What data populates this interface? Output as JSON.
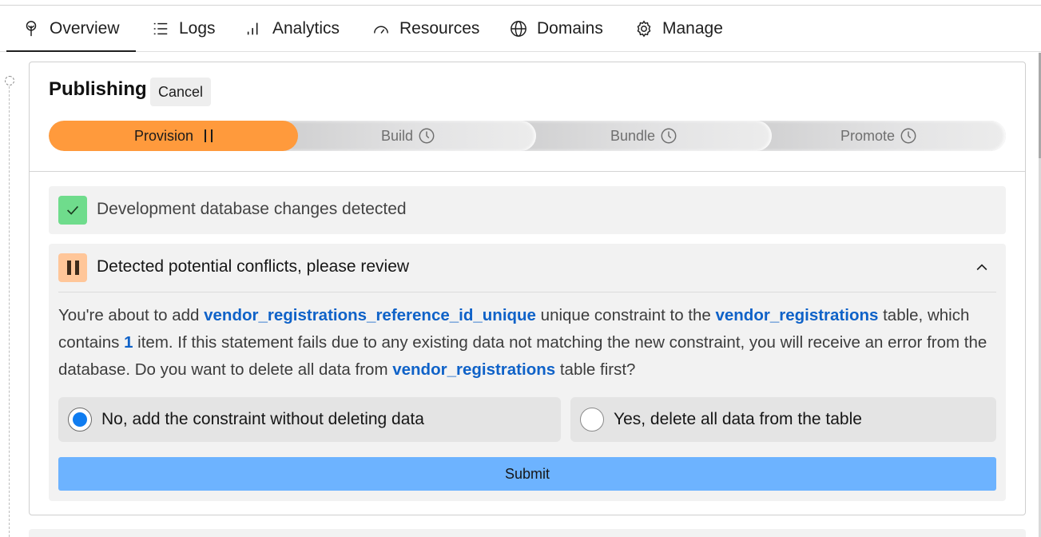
{
  "tabs": [
    {
      "label": "Overview",
      "icon": "tree-icon",
      "active": true
    },
    {
      "label": "Logs",
      "icon": "list-icon",
      "active": false
    },
    {
      "label": "Analytics",
      "icon": "bar-chart-icon",
      "active": false
    },
    {
      "label": "Resources",
      "icon": "gauge-icon",
      "active": false
    },
    {
      "label": "Domains",
      "icon": "globe-icon",
      "active": false
    },
    {
      "label": "Manage",
      "icon": "gear-icon",
      "active": false
    }
  ],
  "publishing": {
    "title": "Publishing",
    "cancel_label": "Cancel",
    "steps": [
      {
        "label": "Provision",
        "status": "paused"
      },
      {
        "label": "Build",
        "status": "pending"
      },
      {
        "label": "Bundle",
        "status": "pending"
      },
      {
        "label": "Promote",
        "status": "pending"
      }
    ],
    "checks": {
      "dev_db": {
        "label": "Development database changes detected",
        "status": "success"
      }
    },
    "conflict": {
      "heading": "Detected potential conflicts, please review",
      "description": {
        "p1": "You're about to add ",
        "constraint": "vendor_registrations_reference_id_unique",
        "p2": " unique constraint to the ",
        "table": "vendor_registrations",
        "p3": " table, which contains ",
        "count": "1",
        "p4": " item. If this statement fails due to any existing data not matching the new constraint, you will receive an error from the database. Do you want to delete all data from ",
        "table2": "vendor_registrations",
        "p5": " table first?"
      },
      "options": [
        {
          "label": "No, add the constraint without deleting data",
          "selected": true
        },
        {
          "label": "Yes, delete all data from the table",
          "selected": false
        }
      ],
      "submit_label": "Submit"
    }
  },
  "colors": {
    "accent_orange": "#ff9a3c",
    "success_green": "#6fdc8c",
    "warning_peach": "#ffc699",
    "link_blue": "#0f62c8",
    "submit_blue": "#6db3ff",
    "radio_blue": "#0f7cf0"
  }
}
